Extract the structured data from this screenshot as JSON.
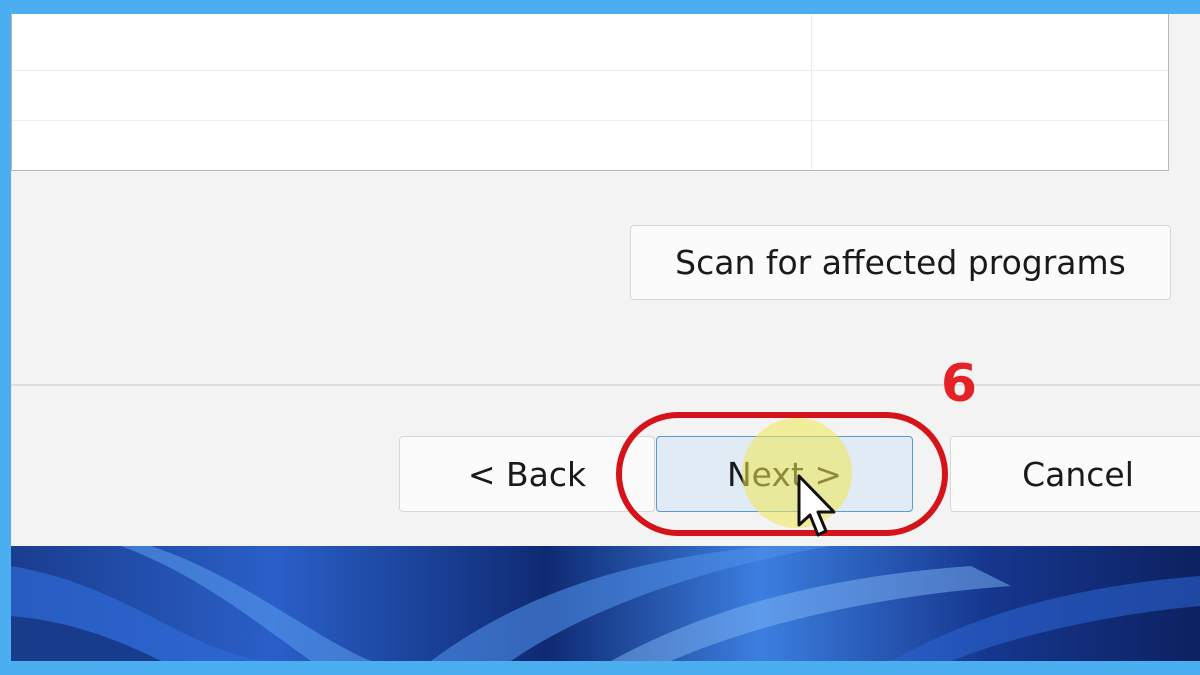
{
  "dialog": {
    "scan_button_label": "Scan for affected programs",
    "back_button_label": "< Back",
    "next_button_label": "Next >",
    "cancel_button_label": "Cancel"
  },
  "annotation": {
    "step_number": "6",
    "highlight_color": "#d4141a"
  },
  "colors": {
    "frame_border": "#4aaef0",
    "next_button_bg": "#e1ebf6",
    "next_button_border": "#5b9bd5"
  },
  "icons": {
    "cursor": "arrow-pointer-icon"
  }
}
